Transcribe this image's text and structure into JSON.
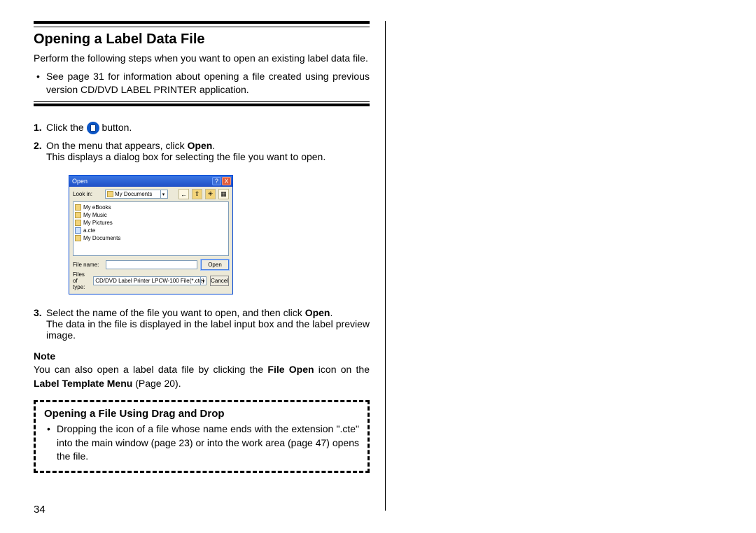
{
  "page_number": "34",
  "title": "Opening a Label Data File",
  "intro": "Perform the following steps when you want to open an existing label data file.",
  "intro_bullet": "See page 31 for information about opening a file created using previous version CD/DVD LABEL PRINTER application.",
  "step1": {
    "num": "1.",
    "a": "Click the ",
    "b": " button."
  },
  "step2": {
    "num": "2.",
    "a": "On the menu that appears, click ",
    "open": "Open",
    "b": ".",
    "cont": "This displays a dialog box for selecting the file you want to open."
  },
  "dialog": {
    "title": "Open",
    "help": "?",
    "close": "X",
    "lookin_label": "Look in:",
    "lookin_value": "My Documents",
    "files": [
      "My eBooks",
      "My Music",
      "My Pictures",
      "a.cte",
      "My Documents"
    ],
    "filename_label": "File name:",
    "filename_value": "",
    "filetype_label": "Files of type:",
    "filetype_value": "CD/DVD Label Printer LPCW-100 File(*.cte)",
    "open_btn": "Open",
    "cancel_btn": "Cancel"
  },
  "step3": {
    "num": "3.",
    "a": "Select the name of the file you want to open, and then click ",
    "open": "Open",
    "b": ".",
    "cont": "The data in the file is displayed in the label input box and the label preview image."
  },
  "note": {
    "heading": "Note",
    "a": "You can also open a label data file by clicking the ",
    "fo": "File Open",
    "b": " icon on the ",
    "ltm": "Label Template Menu",
    "c": " (Page 20)."
  },
  "dragdrop": {
    "heading": "Opening a File Using Drag and Drop",
    "text": "Dropping the icon of a file whose name ends with the extension \".cte\" into the main window (page 23) or into the work area (page 47) opens the file."
  }
}
